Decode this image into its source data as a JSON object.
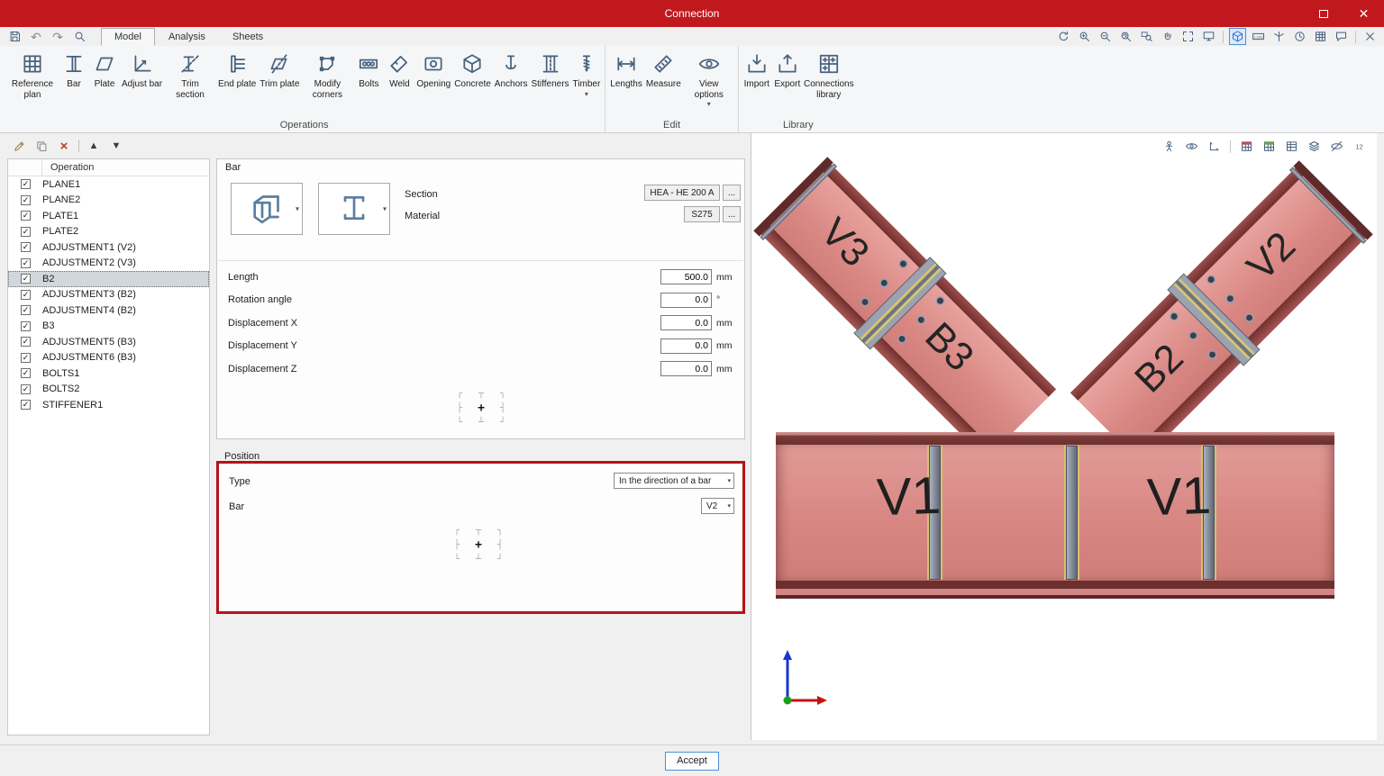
{
  "window": {
    "title": "Connection"
  },
  "icons": {
    "undo": "↶",
    "redo": "↷",
    "dropdown": "▾",
    "close": "✕",
    "check": "✓",
    "move-up": "▲",
    "move-down": "▼",
    "delete": "×"
  },
  "align_marks": [
    "┌",
    "┬",
    "┐",
    "├",
    "+",
    "┤",
    "└",
    "┴",
    "┘"
  ],
  "quick_toolbar": [
    "save",
    "undo",
    "redo",
    "search"
  ],
  "tabs": [
    {
      "label": "Model",
      "active": true
    },
    {
      "label": "Analysis",
      "active": false
    },
    {
      "label": "Sheets",
      "active": false
    }
  ],
  "view_toolbar": [
    "rotate-view",
    "zoom-in",
    "zoom-out",
    "zoom-all",
    "zoom-window",
    "pan",
    "fit-view",
    "full-screen",
    "|",
    "shaded-view",
    "scale-1-100",
    "axonometry",
    "view-history",
    "report-table",
    "comment",
    "|",
    "close-pane"
  ],
  "viewport_toolbar": [
    "human-figure",
    "view-direction",
    "ucs",
    "|",
    "member-colors",
    "plate-colors",
    "results-table",
    "layers",
    "hide-objects",
    "numbering"
  ],
  "list_toolbar": [
    "edit",
    "copy",
    "delete",
    "|",
    "move-up",
    "move-down"
  ],
  "ribbon": {
    "groups": [
      {
        "label": "Operations",
        "buttons": [
          {
            "label": "Reference plan",
            "icon": "reference-plan"
          },
          {
            "label": "Bar",
            "icon": "bar"
          },
          {
            "label": "Plate",
            "icon": "plate"
          },
          {
            "label": "Adjust bar",
            "icon": "adjust-bar"
          },
          {
            "label": "Trim section",
            "icon": "trim-section"
          },
          {
            "label": "End plate",
            "icon": "end-plate"
          },
          {
            "label": "Trim plate",
            "icon": "trim-plate"
          },
          {
            "label": "Modify corners",
            "icon": "modify-corners"
          },
          {
            "label": "Bolts",
            "icon": "bolts"
          },
          {
            "label": "Weld",
            "icon": "weld"
          },
          {
            "label": "Opening",
            "icon": "opening"
          },
          {
            "label": "Concrete",
            "icon": "concrete"
          },
          {
            "label": "Anchors",
            "icon": "anchors"
          },
          {
            "label": "Stiffeners",
            "icon": "stiffeners"
          },
          {
            "label": "Timber",
            "icon": "timber",
            "dropdown": true
          }
        ]
      },
      {
        "label": "Edit",
        "buttons": [
          {
            "label": "Lengths",
            "icon": "lengths"
          },
          {
            "label": "Measure",
            "icon": "measure"
          },
          {
            "label": "View options",
            "icon": "view-options",
            "dropdown": true
          }
        ]
      },
      {
        "label": "Library",
        "buttons": [
          {
            "label": "Import",
            "icon": "import"
          },
          {
            "label": "Export",
            "icon": "export"
          },
          {
            "label": "Connections library",
            "icon": "connections-library"
          }
        ]
      }
    ]
  },
  "operations": {
    "header": "Operation",
    "items": [
      {
        "label": "PLANE1",
        "checked": true,
        "selected": false
      },
      {
        "label": "PLANE2",
        "checked": true,
        "selected": false
      },
      {
        "label": "PLATE1",
        "checked": true,
        "selected": false
      },
      {
        "label": "PLATE2",
        "checked": true,
        "selected": false
      },
      {
        "label": "ADJUSTMENT1 (V2)",
        "checked": true,
        "selected": false
      },
      {
        "label": "ADJUSTMENT2 (V3)",
        "checked": true,
        "selected": false
      },
      {
        "label": "B2",
        "checked": true,
        "selected": true
      },
      {
        "label": "ADJUSTMENT3 (B2)",
        "checked": true,
        "selected": false
      },
      {
        "label": "ADJUSTMENT4 (B2)",
        "checked": true,
        "selected": false
      },
      {
        "label": "B3",
        "checked": true,
        "selected": false
      },
      {
        "label": "ADJUSTMENT5 (B3)",
        "checked": true,
        "selected": false
      },
      {
        "label": "ADJUSTMENT6 (B3)",
        "checked": true,
        "selected": false
      },
      {
        "label": "BOLTS1",
        "checked": true,
        "selected": false
      },
      {
        "label": "BOLTS2",
        "checked": true,
        "selected": false
      },
      {
        "label": "STIFFENER1",
        "checked": true,
        "selected": false
      }
    ]
  },
  "bar_panel": {
    "title": "Bar",
    "section_label": "Section",
    "section_value": "HEA - HE 200 A",
    "material_label": "Material",
    "material_value": "S275",
    "more_label": "...",
    "fields": [
      {
        "label": "Length",
        "value": "500.0",
        "unit": "mm"
      },
      {
        "label": "Rotation angle",
        "value": "0.0",
        "unit": "°"
      },
      {
        "label": "Displacement X",
        "value": "0.0",
        "unit": "mm"
      },
      {
        "label": "Displacement Y",
        "value": "0.0",
        "unit": "mm"
      },
      {
        "label": "Displacement Z",
        "value": "0.0",
        "unit": "mm"
      }
    ]
  },
  "position_panel": {
    "title": "Position",
    "type_label": "Type",
    "type_value": "In the direction of a bar",
    "bar_label": "Bar",
    "bar_value": "V2"
  },
  "viewport": {
    "labels": {
      "left_upper": "V3",
      "left_lower": "B3",
      "right_lower": "B2",
      "right_upper": "V2",
      "beam_left": "V1",
      "beam_right": "V1"
    }
  },
  "footer": {
    "accept": "Accept"
  },
  "colors": {
    "titlebar": "#c1181d",
    "selection_red": "#b5121b",
    "beam_face": "#dd8f8c",
    "beam_edge": "#703434",
    "stiffener": "#8e97a6",
    "accent_blue": "#4a90d9"
  }
}
